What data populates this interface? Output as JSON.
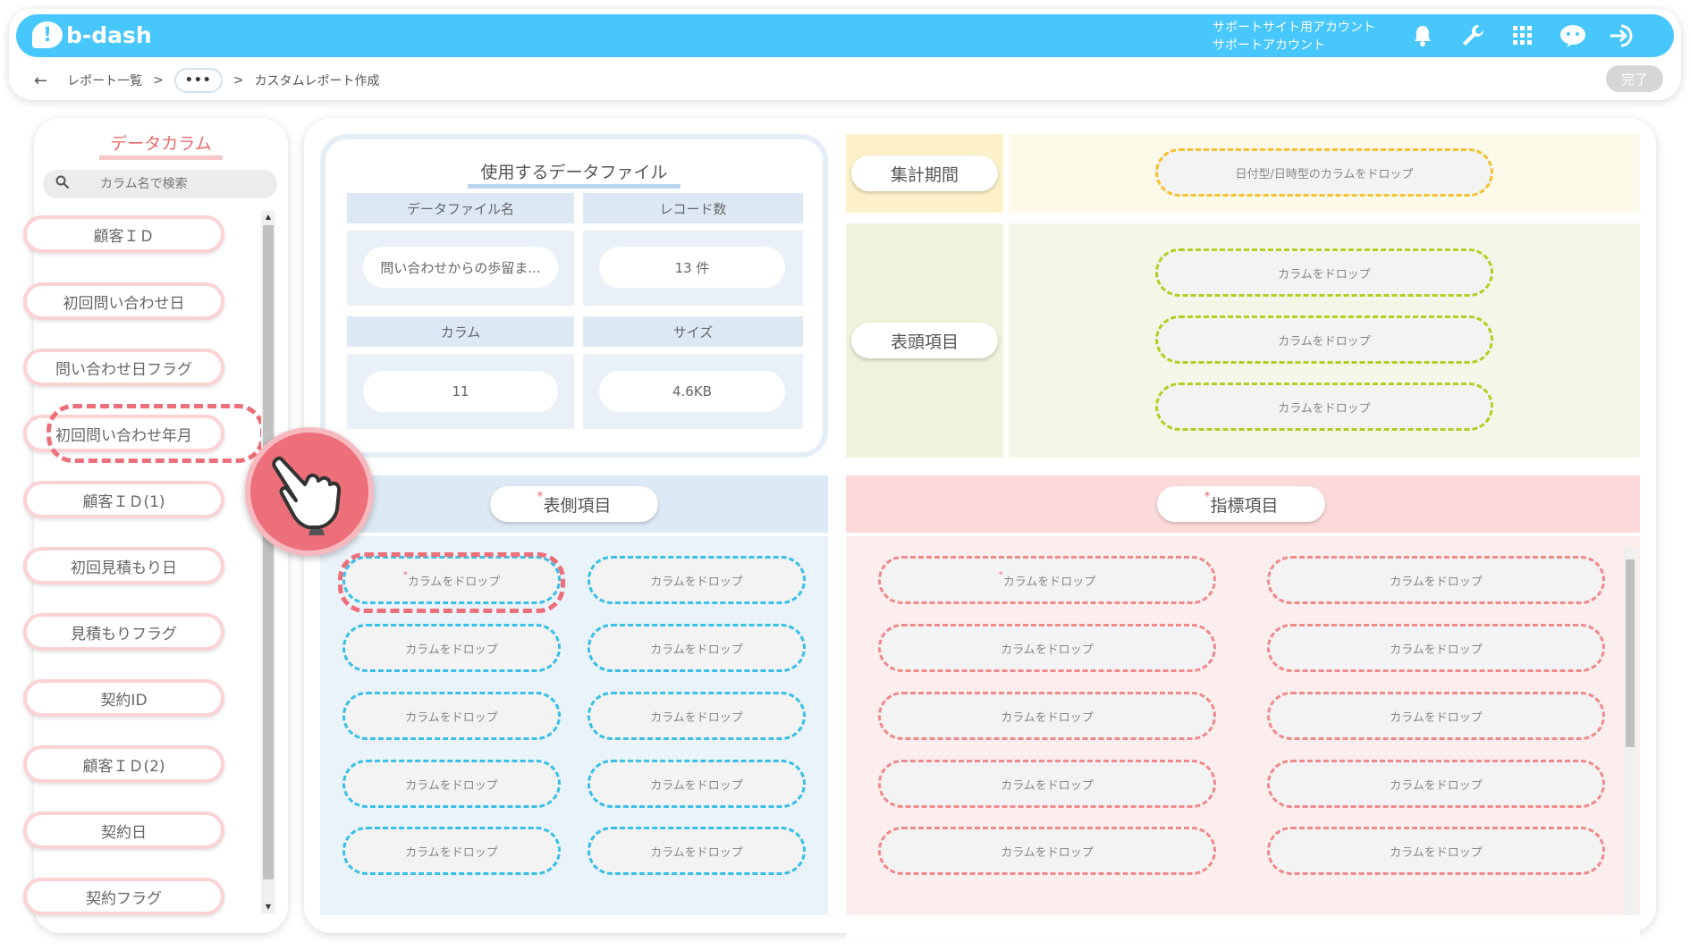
{
  "header": {
    "logo_text": "b-dash",
    "account_line1": "サポートサイト用アカウント",
    "account_line2": "サポートアカウント",
    "icons": [
      "bell-icon",
      "wrench-icon",
      "apps-grid-icon",
      "support-chat-icon",
      "logout-icon"
    ],
    "color": "#47c7fb"
  },
  "breadcrumb": {
    "back": "←",
    "item1": "レポート一覧",
    "sep": ">",
    "ellipsis": "•••",
    "current": "カスタムレポート作成"
  },
  "done_button": "完了",
  "sidebar": {
    "title": "データカラム",
    "search_placeholder": "カラム名で検索",
    "items": [
      {
        "label": "顧客ＩＤ"
      },
      {
        "label": "初回問い合わせ日"
      },
      {
        "label": "問い合わせ日フラグ"
      },
      {
        "label": "初回問い合わせ年月"
      },
      {
        "label": "顧客ＩＤ(1)"
      },
      {
        "label": "初回見積もり日"
      },
      {
        "label": "見積もりフラグ"
      },
      {
        "label": "契約ID"
      },
      {
        "label": "顧客ＩＤ(2)"
      },
      {
        "label": "契約日"
      },
      {
        "label": "契約フラグ"
      }
    ]
  },
  "data_file": {
    "title": "使用するデータファイル",
    "file_name_label": "データファイル名",
    "file_name_value": "問い合わせからの歩留ま...",
    "record_label": "レコード数",
    "record_value": "13 件",
    "column_label": "カラム",
    "column_value": "11",
    "size_label": "サイズ",
    "size_value": "4.6KB"
  },
  "period": {
    "label": "集計期間",
    "drop": "日付型/日時型のカラムをドロップ",
    "color": "#f3c22c"
  },
  "header_items": {
    "label": "表頭項目",
    "drops": [
      "カラムをドロップ",
      "カラムをドロップ",
      "カラムをドロップ"
    ],
    "color": "#b3cf22"
  },
  "side_items": {
    "label": "表側項目",
    "required_mark": "*",
    "drop": "カラムをドロップ",
    "color": "#38c0e6"
  },
  "metric_items": {
    "label": "指標項目",
    "required_mark": "*",
    "drop": "カラムをドロップ",
    "color": "#f08a8a"
  },
  "accent_color": "#ec6f7a"
}
